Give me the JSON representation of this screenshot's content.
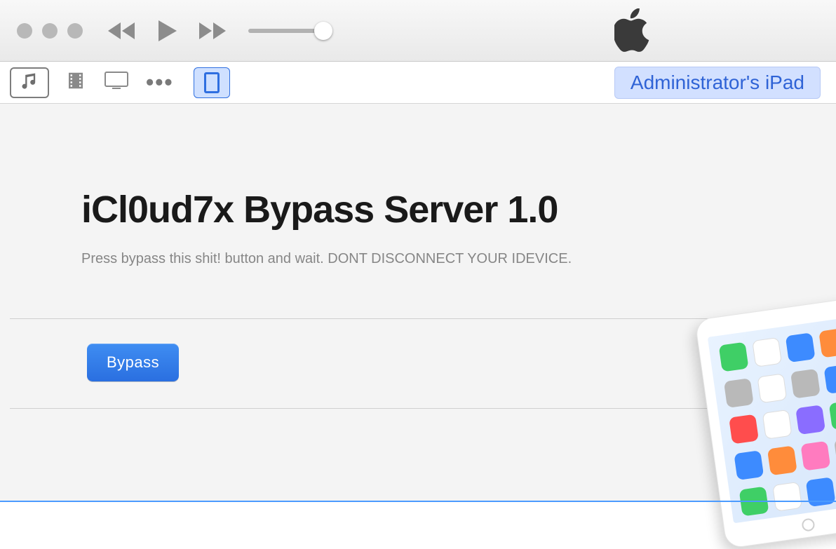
{
  "device": {
    "name": "Administrator's iPad"
  },
  "page": {
    "title": "iCl0ud7x Bypass Server 1.0",
    "subtitle": "Press bypass this shit! button and wait. DONT DISCONNECT YOUR IDEVICE.",
    "bypass_label": "Bypass"
  },
  "icons": {
    "music": "music-icon",
    "movies": "film-icon",
    "tv": "tv-icon",
    "more": "ellipsis-icon",
    "device": "ipad-icon",
    "apple": "apple-logo-icon",
    "prev": "rewind-icon",
    "play": "play-icon",
    "next": "fastforward-icon"
  }
}
